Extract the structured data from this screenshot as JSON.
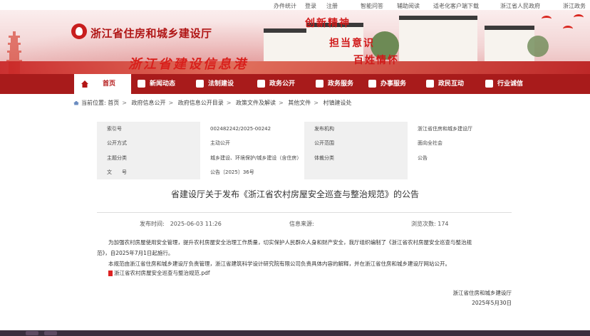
{
  "topbar": {
    "links": [
      "办件统计",
      "登录",
      "注册",
      "智能问答",
      "辅助阅读",
      "适老化客户端下载",
      "浙江省人民政府",
      "浙江政务"
    ]
  },
  "banner": {
    "site_title": "浙江省住房和城乡建设厅",
    "subtitle": "浙江省建设信息港",
    "slogans": [
      "创新精神",
      "担当意识",
      "百姓情怀"
    ]
  },
  "nav": {
    "items": [
      {
        "label": "首页",
        "icon": "home-icon"
      },
      {
        "label": "新闻动态",
        "icon": "news-icon"
      },
      {
        "label": "法制建设",
        "icon": "law-icon"
      },
      {
        "label": "政务公开",
        "icon": "gov-open-icon"
      },
      {
        "label": "政务服务",
        "icon": "service-icon"
      },
      {
        "label": "办事服务",
        "icon": "affairs-icon"
      },
      {
        "label": "政民互动",
        "icon": "interaction-icon"
      },
      {
        "label": "行业诚信",
        "icon": "credit-icon"
      }
    ]
  },
  "breadcrumb": {
    "prefix": "当前位置:",
    "items": [
      "首页",
      "政府信息公开",
      "政府信息公开目录",
      "政策文件及解读",
      "其他文件",
      "村镇建设处"
    ]
  },
  "meta": {
    "rows": [
      {
        "k1": "索引号",
        "v1": "002482242/2025-00242",
        "k2": "发布机构",
        "v2": "浙江省住房和城乡建设厅"
      },
      {
        "k1": "公开方式",
        "v1": "主动公开",
        "k2": "公开范围",
        "v2": "面向全社会"
      },
      {
        "k1": "主题分类",
        "v1": "城乡建设、环境保护/城乡建设（含住房）",
        "k2": "体裁分类",
        "v2": "公告"
      },
      {
        "k1": "文　　号",
        "v1": "公告〔2025〕36号",
        "k2": "",
        "v2": ""
      }
    ]
  },
  "document": {
    "title": "省建设厅关于发布《浙江省农村房屋安全巡查与整治规范》的公告",
    "publish_time": "发布时间:　2025-06-03 11:26",
    "source": "信息来源:",
    "views": "浏览次数: 174",
    "para1_line1": "为加强农村房屋使用安全管理，提升农村房屋安全治理工作质量，切实保护人民群众人身和财产安全，我厅组织编制了《浙江省农村房屋安全巡查与整治规",
    "para1_line2": "范》，自2025年7月1日起施行。",
    "para2": "本规范由浙江省住房和城乡建设厅负责管理，浙江省建筑科学设计研究院有限公司负责具体内容的解释，并在浙江省住房和城乡建设厅网站公开。",
    "attachment": "浙江省农村房屋安全巡查与整治规范.pdf",
    "signature_org": "浙江省住房和城乡建设厅",
    "signature_date": "2025年5月30日"
  },
  "colors": {
    "nav_bg": "#a81b1b",
    "brand_red": "#b01515"
  }
}
